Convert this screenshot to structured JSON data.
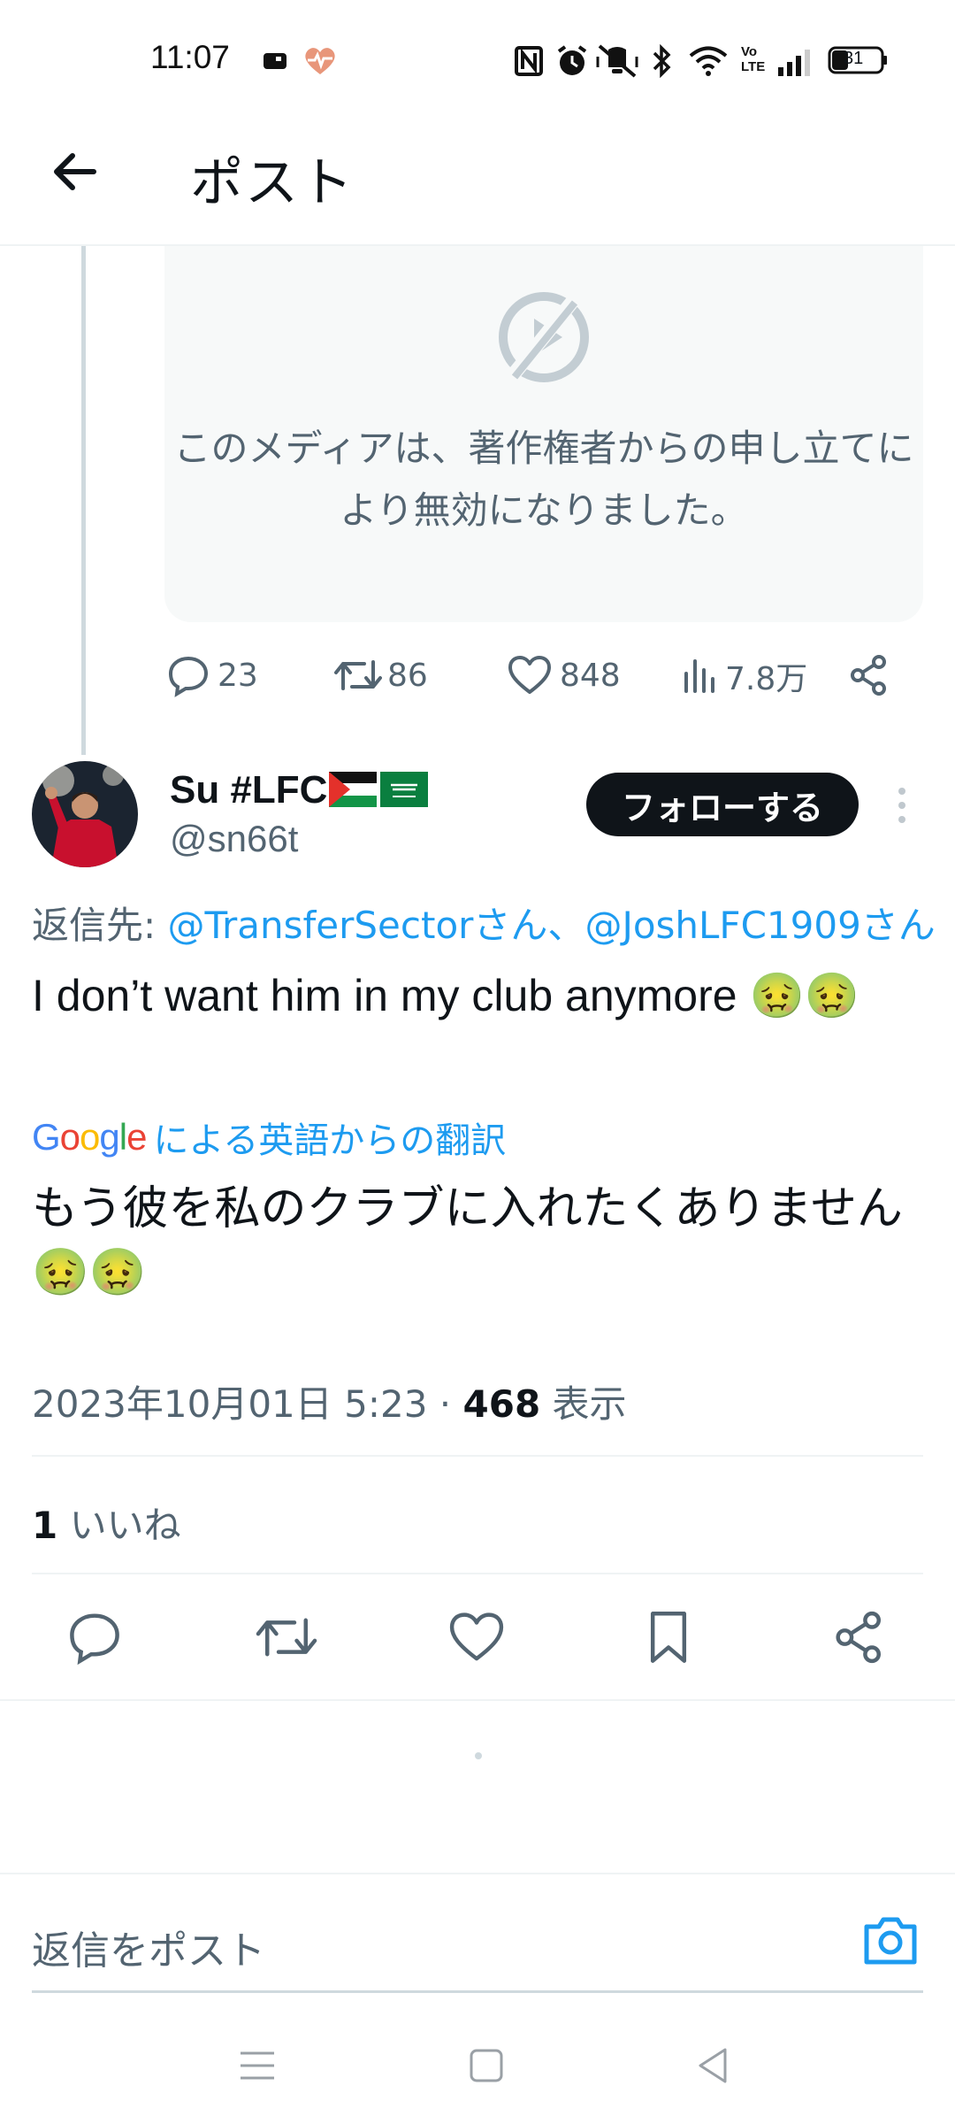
{
  "status_bar": {
    "time": "11:07",
    "battery": "31",
    "icons": [
      "nfc-icon",
      "alarm-icon",
      "vibrate-icon",
      "bluetooth-icon",
      "wifi-icon",
      "volte-icon",
      "signal-icon",
      "battery-icon"
    ]
  },
  "header": {
    "title": "ポスト"
  },
  "media": {
    "message": "このメディアは、著作権者からの申し立てにより無効になりました。"
  },
  "quoted_stats": {
    "replies": "23",
    "retweets": "86",
    "likes": "848",
    "views": "7.8万"
  },
  "author": {
    "name": "Su #LFC",
    "handle": "@sn66t",
    "follow_label": "フォローする"
  },
  "reply_to": {
    "prefix": "返信先: ",
    "first": "@TransferSectorさん",
    "separator": "、",
    "second": "@JoshLFC1909さん"
  },
  "tweet": {
    "text": "I don’t want him in my club anymore 🤢🤢",
    "translation_label": "による英語からの翻訳",
    "translation_provider": "Google",
    "translated_text": "もう彼を私のクラブに入れたくありません🤢🤢"
  },
  "meta": {
    "date": "2023年10月01日 5:23 · ",
    "views": "468",
    "views_label": " 表示"
  },
  "likes": {
    "count": "1",
    "label": " いいね"
  },
  "composer": {
    "placeholder": "返信をポスト"
  },
  "colors": {
    "accent": "#1d9bf0",
    "text": "#0f1419",
    "muted": "#536471"
  }
}
